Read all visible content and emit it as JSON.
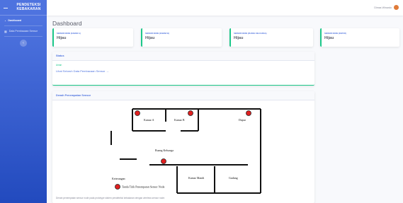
{
  "sidebar": {
    "brand_title": "PENDETEKSI KEBAKARAN",
    "items": [
      {
        "label": "Dashboard",
        "icon": "tachometer-icon"
      },
      {
        "label": "Data Pembacaan Sensor",
        "icon": "table-icon"
      }
    ],
    "toggle_glyph": "‹"
  },
  "topbar": {
    "user_name": "Dimas Winardo"
  },
  "page_title": "Dashboard",
  "stats": [
    {
      "label": "SENSOR NODE (KAMAR A)",
      "value": "Hijau"
    },
    {
      "label": "SENSOR NODE (KAMAR B)",
      "value": "Hijau"
    },
    {
      "label": "SENSOR NODE (RUANG KELUARGA)",
      "value": "Hijau"
    },
    {
      "label": "SENSOR NODE (DAPUR)",
      "value": "Hijau"
    }
  ],
  "status_card": {
    "title": "Status",
    "subtitle": "Aman",
    "link": "Lihat Seluruh Data Pembacaan Sensor →"
  },
  "layout_card": {
    "title": "Denah Penempatan Sensor",
    "rooms": {
      "kamar_a": "Kamar A",
      "kamar_b": "Kamar B",
      "dapur": "Dapur",
      "ruang_keluarga": "Ruang Keluarga",
      "kamar_mandi": "Kamar Mandi",
      "gudang": "Gudang"
    },
    "legend_title": "Keterangan:",
    "legend_item": "Tanda Titik Penempatan Sensor Node",
    "caption": "Denah penempatan sensor node pada prototype sistem pendeteksi kebakaran dengan wireless sensor node."
  },
  "colors": {
    "primary": "#4e73df",
    "success": "#1cc88a",
    "sensor": "#e02020"
  }
}
